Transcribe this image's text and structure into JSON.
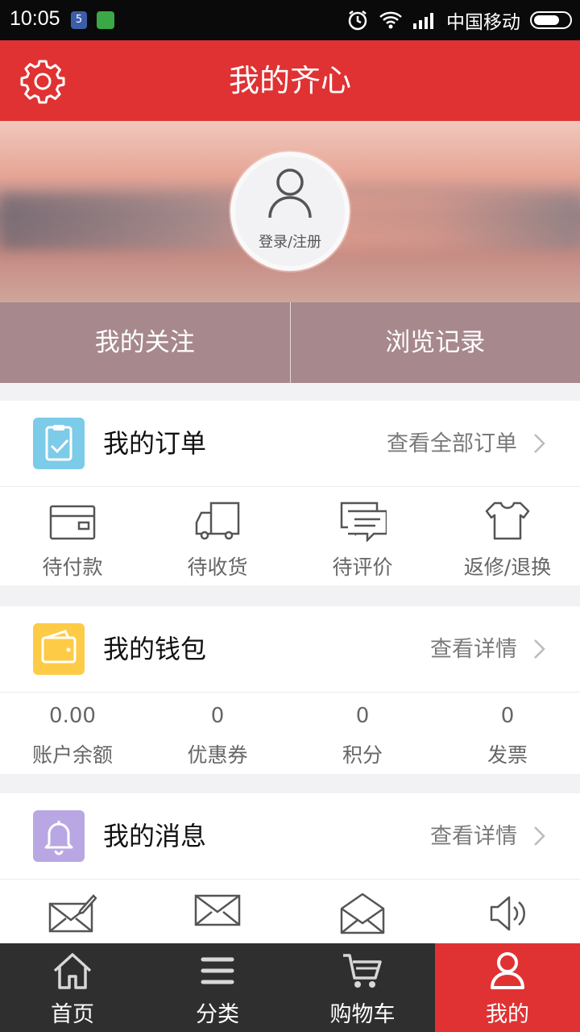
{
  "status_bar": {
    "time": "10:05",
    "carrier": "中国移动",
    "badge": "5"
  },
  "header": {
    "title": "我的齐心",
    "settings_icon": "gear-icon"
  },
  "profile": {
    "login_label": "登录/注册"
  },
  "quick_links": [
    {
      "label": "我的关注"
    },
    {
      "label": "浏览记录"
    }
  ],
  "orders": {
    "title": "我的订单",
    "link": "查看全部订单",
    "icon_color": "#7ccbe8",
    "items": [
      {
        "label": "待付款",
        "icon": "wallet-card-icon"
      },
      {
        "label": "待收货",
        "icon": "truck-icon"
      },
      {
        "label": "待评价",
        "icon": "comment-icon"
      },
      {
        "label": "返修/退换",
        "icon": "return-shirt-icon"
      }
    ]
  },
  "wallet": {
    "title": "我的钱包",
    "link": "查看详情",
    "icon_color": "#fdcb45",
    "items": [
      {
        "value": "0.00",
        "label": "账户余额"
      },
      {
        "value": "0",
        "label": "优惠券"
      },
      {
        "value": "0",
        "label": "积分"
      },
      {
        "value": "0",
        "label": "发票"
      }
    ]
  },
  "messages": {
    "title": "我的消息",
    "link": "查看详情",
    "icon_color": "#b9a7e3",
    "items": [
      {
        "icon": "compose-mail-icon"
      },
      {
        "icon": "mail-icon"
      },
      {
        "icon": "open-mail-icon"
      },
      {
        "icon": "speaker-icon"
      }
    ]
  },
  "bottom_nav": [
    {
      "label": "首页",
      "icon": "home-icon"
    },
    {
      "label": "分类",
      "icon": "menu-icon"
    },
    {
      "label": "购物车",
      "icon": "cart-icon"
    },
    {
      "label": "我的",
      "icon": "user-icon",
      "active": true
    }
  ],
  "colors": {
    "brand_red": "#e03233",
    "nav_dark": "#2f2f2f",
    "quicklinks_bg": "#a6888d"
  }
}
